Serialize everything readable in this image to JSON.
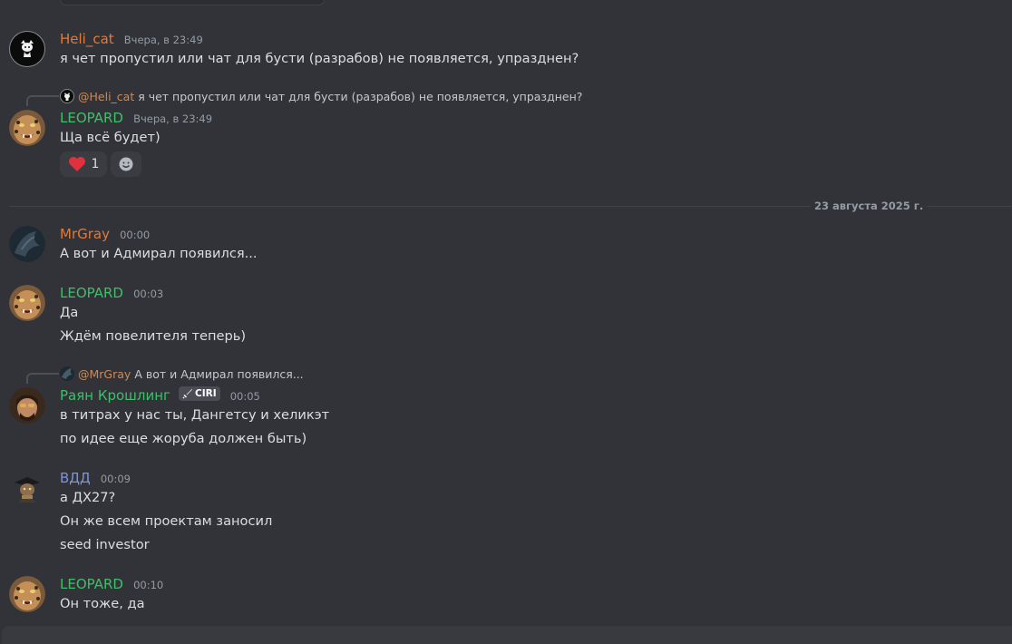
{
  "colors": {
    "bg": "#313338",
    "heli": "#e07a3c",
    "leopard": "#3fbf6a",
    "mrgray": "#e07a3c",
    "ryan": "#3fbf6a",
    "vdd": "#7f95d6",
    "mention": "#c98a5c"
  },
  "messages": [
    {
      "user": "Heli_cat",
      "time": "Вчера, в 23:49",
      "lines": [
        "я чет пропустил или чат для бусти (разрабов) не появляется, упразднен?"
      ]
    },
    {
      "reply_to": {
        "mention": "@Heli_cat",
        "text": "я чет пропустил или чат для бусти (разрабов) не появляется, упразднен?"
      },
      "user": "LEOPARD",
      "time": "Вчера, в 23:49",
      "lines": [
        "Ща всё будет)"
      ],
      "reactions": [
        {
          "icon": "heart-icon",
          "count": "1"
        },
        {
          "icon": "add-reaction-icon"
        }
      ]
    },
    {
      "user": "MrGray",
      "time": "00:00",
      "lines": [
        "А вот и Адмирал появился..."
      ]
    },
    {
      "user": "LEOPARD",
      "time": "00:03",
      "lines": [
        "Да",
        "Ждём повелителя теперь)"
      ]
    },
    {
      "reply_to": {
        "mention": "@MrGray",
        "text": "А вот и Адмирал появился..."
      },
      "user": "Раян Крошлинг",
      "tag": "CIRI",
      "time": "00:05",
      "lines": [
        "в титрах у нас ты, Дангетсу и хеликэт",
        "по идее еще жоруба должен быть)"
      ]
    },
    {
      "user": "ВДД",
      "time": "00:09",
      "lines": [
        "а ДХ27?",
        "Он же всем проектам заносил",
        "seed investor"
      ]
    },
    {
      "user": "LEOPARD",
      "time": "00:10",
      "lines": [
        "Он тоже, да"
      ]
    }
  ],
  "date_divider": "23 августа 2025 г."
}
